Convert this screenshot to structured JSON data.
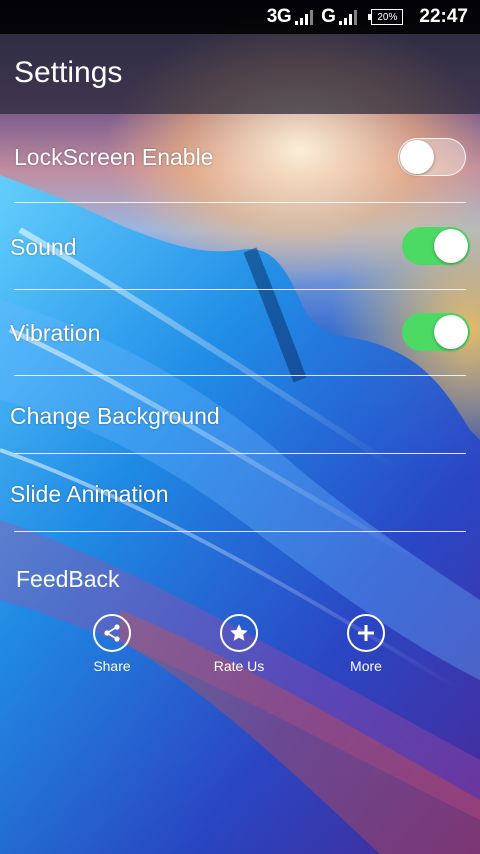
{
  "status_bar": {
    "network1": "3G",
    "network2": "G",
    "battery": "20%",
    "time": "22:47"
  },
  "header": {
    "title": "Settings"
  },
  "settings": [
    {
      "label": "LockScreen Enable",
      "toggle": "off"
    },
    {
      "label": "Sound",
      "toggle": "on"
    },
    {
      "label": "Vibration",
      "toggle": "on"
    },
    {
      "label": "Change Background"
    },
    {
      "label": "Slide Animation"
    }
  ],
  "feedback": {
    "title": "FeedBack",
    "actions": [
      {
        "label": "Share",
        "icon": "share-icon"
      },
      {
        "label": "Rate Us",
        "icon": "star-icon"
      },
      {
        "label": "More",
        "icon": "plus-icon"
      }
    ]
  },
  "colors": {
    "toggle_on": "#4cd964",
    "status_bar": "#000000"
  }
}
